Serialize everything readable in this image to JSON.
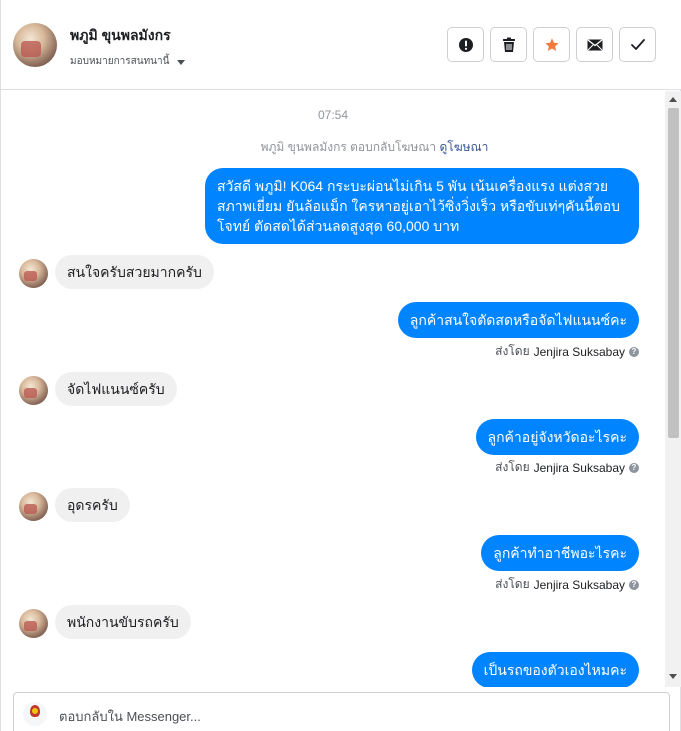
{
  "header": {
    "name": "พภูมิ ขุนพลมังกร",
    "assign_label": "มอบหมายการสนทนานี้",
    "actions": [
      {
        "name": "mark-spam-button",
        "icon": "exclamation-icon"
      },
      {
        "name": "delete-button",
        "icon": "trash-icon"
      },
      {
        "name": "star-button",
        "icon": "star-icon",
        "color": "#f5793b"
      },
      {
        "name": "mark-unread-button",
        "icon": "envelope-icon"
      },
      {
        "name": "mark-done-button",
        "icon": "check-icon"
      }
    ]
  },
  "conversation": {
    "time": "07:54",
    "ad_reply_text": "พภูมิ ขุนพลมังกร ตอบกลับโฆษณา",
    "ad_link": "ดูโฆษณา",
    "sent_by_prefix": "ส่งโดย",
    "sender_name": "Jenjira Suksabay",
    "messages": [
      {
        "dir": "out",
        "text": "สวัสดี พภูมิ! K064 กระบะผ่อนไม่เกิน 5 พัน เน้นเครื่องแรง แต่งสวย สภาพเยี่ยม ยันล้อแม็ก ใครหาอยู่เอาไว้ซิ่งวิ่งเร็ว หรือขับเท่ๆคันนี้ตอบโจทย์ ตัดสดได้ส่วนลดสูงสุด 60,000 บาท"
      },
      {
        "dir": "in",
        "text": "สนใจครับสวยมากครับ"
      },
      {
        "dir": "out",
        "text": "ลูกค้าสนใจตัดสดหรือจัดไฟแนนซ์คะ"
      },
      {
        "dir": "in",
        "text": "จัดไฟแนนซ์ครับ"
      },
      {
        "dir": "out",
        "text": "ลูกค้าอยู่จังหวัดอะไรคะ"
      },
      {
        "dir": "in",
        "text": "อุดรครับ"
      },
      {
        "dir": "out",
        "text": "ลูกค้าทำอาชีพอะไรคะ"
      },
      {
        "dir": "in",
        "text": "พนักงานขับรถครับ"
      },
      {
        "dir": "out",
        "text": "เป็นรถของตัวเองไหมคะ"
      }
    ]
  },
  "composer": {
    "placeholder": "ตอบกลับใน Messenger..."
  },
  "colors": {
    "bubble_out": "#0084ff",
    "bubble_in": "#f1f0f0",
    "link": "#385898",
    "star": "#f5793b"
  }
}
